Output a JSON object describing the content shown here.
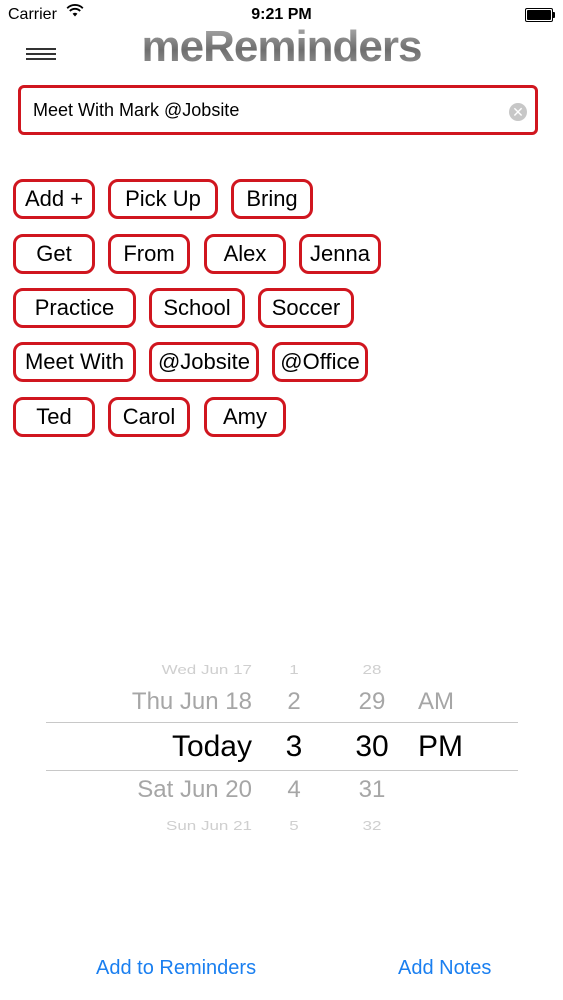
{
  "status_bar": {
    "carrier": "Carrier",
    "time": "9:21 PM",
    "battery_level": 1.0
  },
  "header": {
    "title": "meReminders"
  },
  "reminder_input": {
    "value": "Meet With Mark @Jobsite",
    "placeholder": ""
  },
  "chips": [
    "Add +",
    "Pick Up",
    "Bring",
    "Get",
    "From",
    "Alex",
    "Jenna",
    "Practice",
    "School",
    "Soccer",
    "Meet With",
    "@Jobsite",
    "@Office",
    "Ted",
    "Carol",
    "Amy"
  ],
  "picker": {
    "dates": [
      "Wed Jun 17",
      "Thu Jun 18",
      "Today",
      "Sat Jun 20",
      "Sun Jun 21"
    ],
    "hours": [
      "1",
      "2",
      "3",
      "4",
      "5"
    ],
    "minutes": [
      "28",
      "29",
      "30",
      "31",
      "32"
    ],
    "ampm": [
      "AM",
      "PM"
    ],
    "selected": {
      "date": "Today",
      "hour": "3",
      "minute": "30",
      "ampm": "PM"
    }
  },
  "footer": {
    "add_reminders": "Add to Reminders",
    "add_notes": "Add Notes"
  },
  "colors": {
    "accent": "#d0161f",
    "link": "#1a7ff0",
    "title_gray": "#8a8a8a"
  },
  "icons": {
    "menu": "hamburger-menu-icon",
    "clear": "clear-circle-icon",
    "wifi": "wifi-icon",
    "battery": "battery-icon"
  }
}
